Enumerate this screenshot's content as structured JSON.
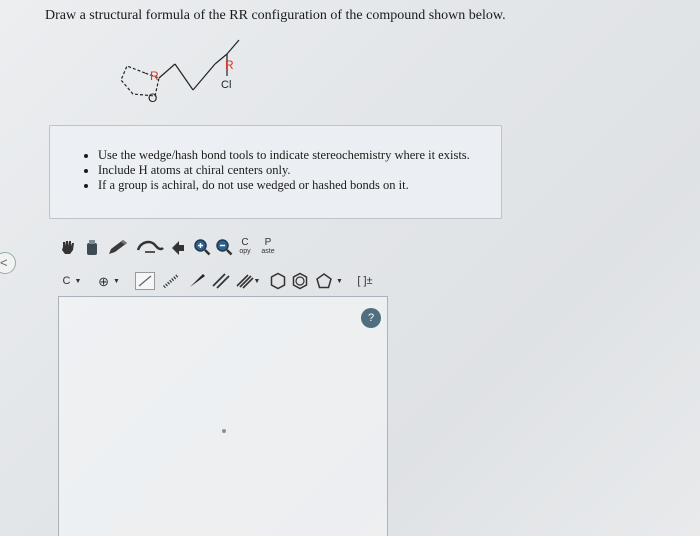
{
  "question": {
    "title": "Draw a structural formula of the RR configuration of the compound shown below."
  },
  "molecule": {
    "label_r_ring": "R",
    "label_r_chain": "R",
    "label_o": "O",
    "label_cl": "Cl"
  },
  "instructions": {
    "items": [
      "Use the wedge/hash bond tools to indicate stereochemistry where it exists.",
      "Include H atoms at chiral centers only.",
      "If a group is achiral, do not use wedged or hashed bonds on it."
    ]
  },
  "toolbar_top": {
    "copy_label_top": "C",
    "copy_label_bottom": "opy",
    "paste_label_top": "P",
    "paste_label_bottom": "aste"
  },
  "toolbar_bottom": {
    "carbon_label": "C",
    "charge_label": "[ ]±"
  },
  "help": {
    "label": "?"
  },
  "icons": {
    "back": "chevron-left-icon",
    "hand": "hand-icon",
    "eraser": "eraser-icon",
    "pencil": "pencil-icon",
    "lasso": "lasso-icon",
    "arrow": "arrow-icon",
    "zoom_in": "zoom-in-icon",
    "zoom_out": "zoom-out-icon"
  },
  "colors": {
    "help_bg": "#4f6f7f",
    "instruction_border": "#b9c4cf"
  }
}
